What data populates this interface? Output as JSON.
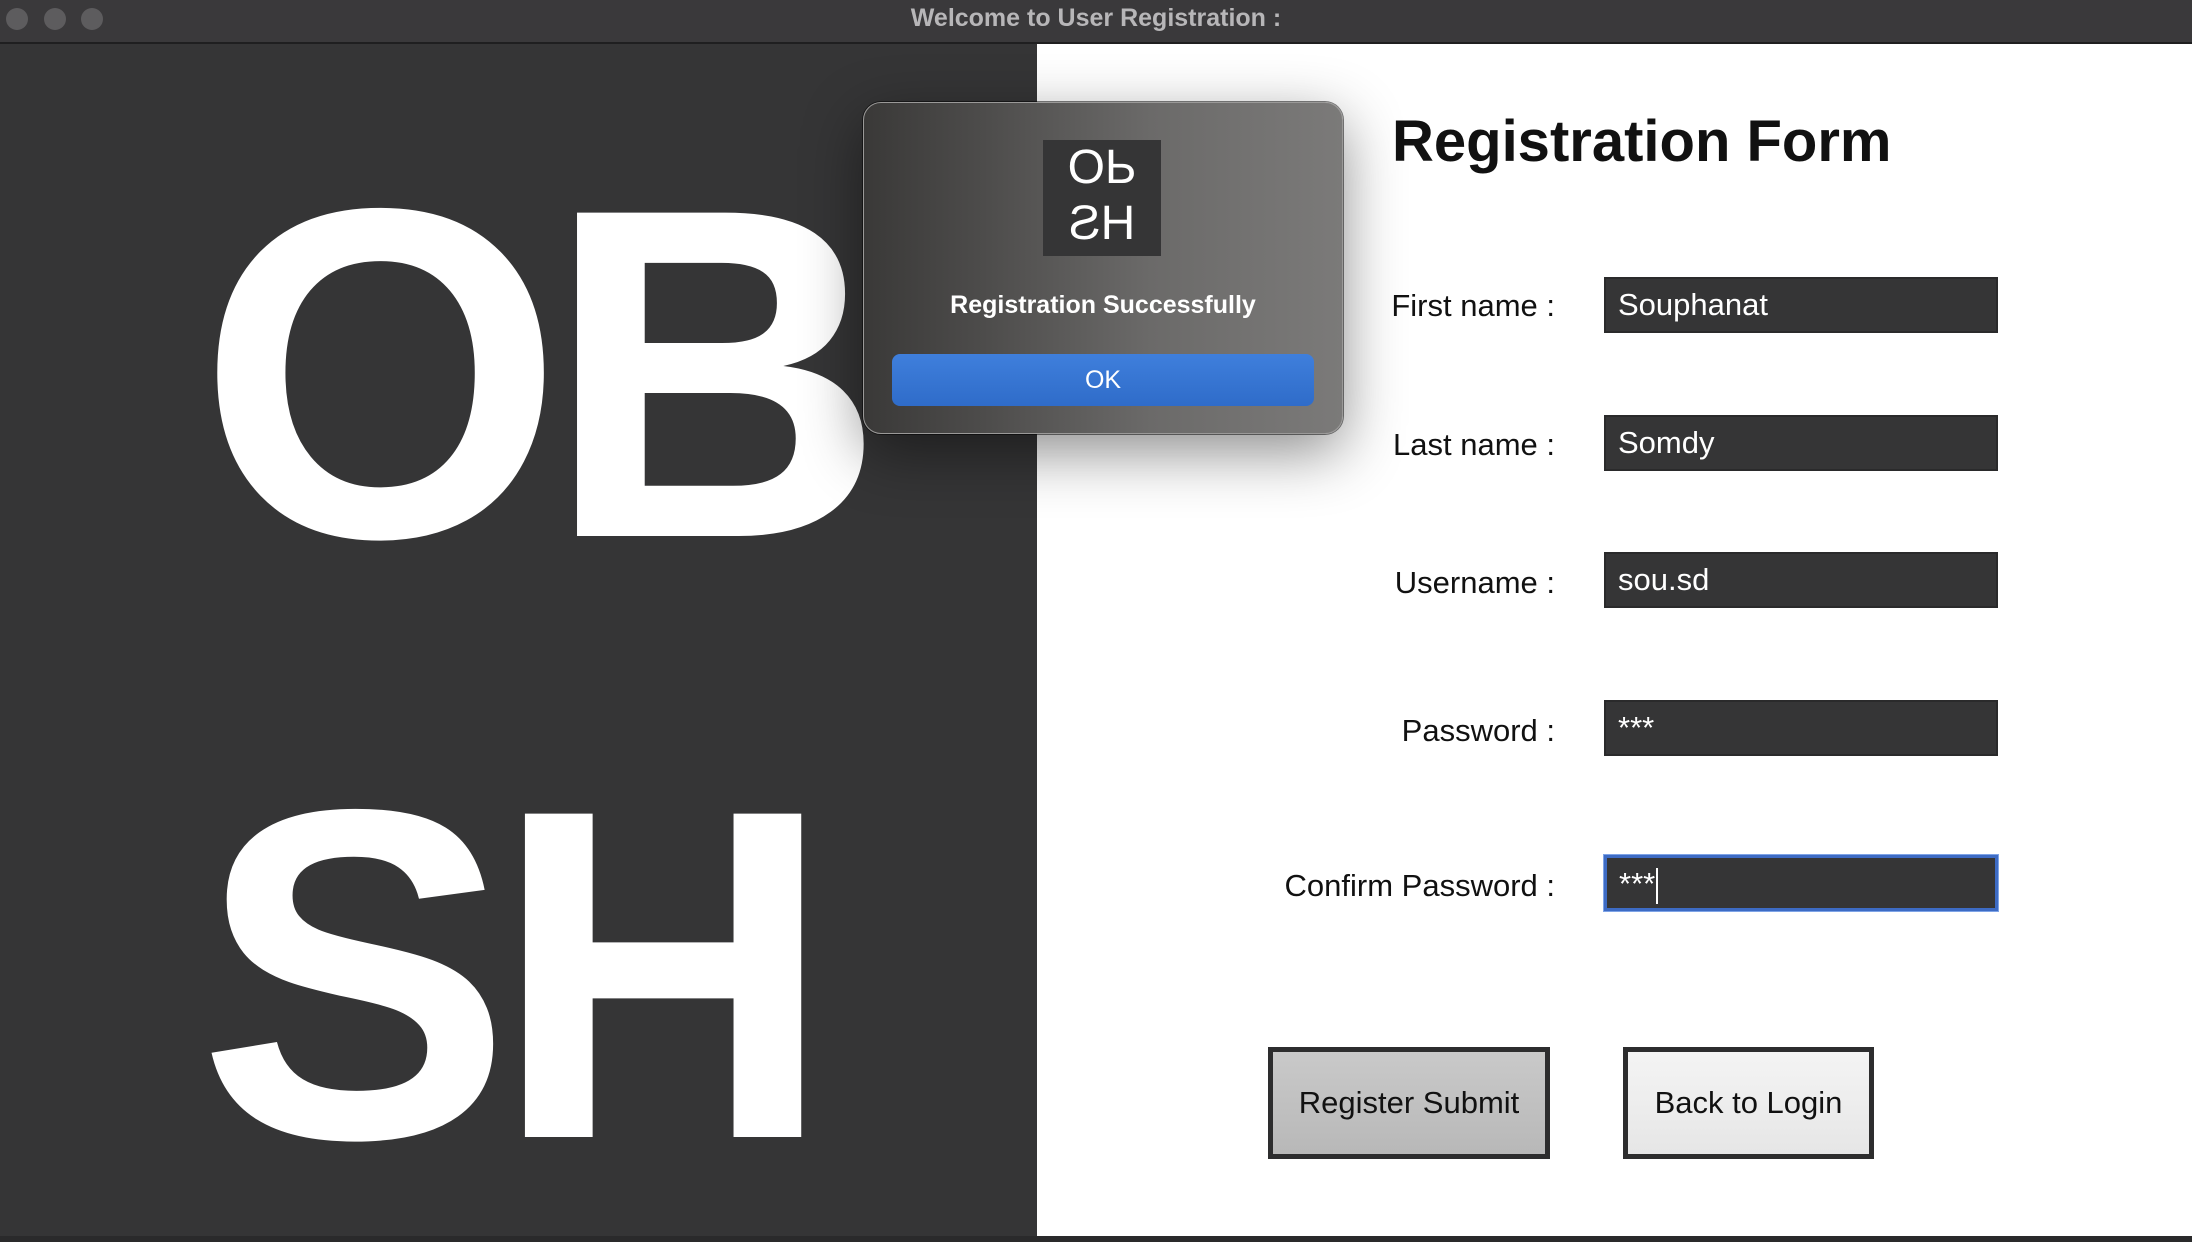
{
  "window": {
    "title": "Welcome to User Registration :"
  },
  "left_panel": {
    "logo_line1": "OB",
    "logo_line2": "SH"
  },
  "form": {
    "title": "Registration Form",
    "fields": [
      {
        "label": "First name :",
        "value": "Souphanat"
      },
      {
        "label": "Last name :",
        "value": "Somdy"
      },
      {
        "label": "Username :",
        "value": "sou.sd"
      },
      {
        "label": "Password :",
        "value": "***"
      },
      {
        "label": "Confirm Password :",
        "value": "***"
      }
    ],
    "submit_label": "Register Submit",
    "back_label": "Back to Login"
  },
  "dialog": {
    "icon_line1": "OЬ",
    "icon_line2": "ƧH",
    "message": "Registration Successfully",
    "ok_label": "OK"
  },
  "colors": {
    "dark_panel": "#353536",
    "accent_blue": "#2f6cc9"
  }
}
